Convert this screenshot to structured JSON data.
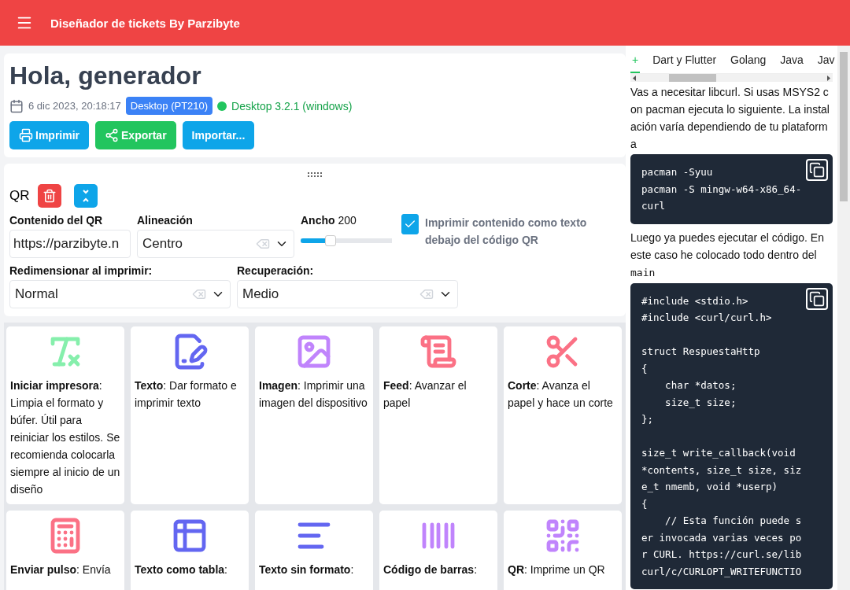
{
  "header": {
    "title": "Diseñador de tickets By Parzibyte"
  },
  "summary": {
    "heading": "Hola, generador",
    "date": "6 dic 2023, 20:18:17",
    "printer_badge": "Desktop (PT210)",
    "status": {
      "text": "Desktop 3.2.1 (windows)",
      "color": "#22c55e"
    },
    "buttons": [
      {
        "label": "Imprimir",
        "kind": "print"
      },
      {
        "label": "Exportar",
        "kind": "share"
      },
      {
        "label": "Importar...",
        "kind": "plain"
      }
    ]
  },
  "qr_block": {
    "title": "QR",
    "content": {
      "label": "Contenido del QR",
      "value": "https://parzibyte.n"
    },
    "alignment": {
      "label": "Alineación",
      "value": "Centro"
    },
    "width": {
      "label": "Ancho",
      "reading": "200",
      "level": 0.3
    },
    "print_text": {
      "label": "Imprimir contenido como texto debajo del código QR",
      "checked": true
    },
    "resize": {
      "label": "Redimensionar al imprimir:",
      "value": "Normal"
    },
    "recovery": {
      "label": "Recuperación:",
      "value": "Medio"
    }
  },
  "cards": [
    {
      "kind": "reset",
      "text": "**Iniciar impresora**: Limpia el formato y búfer. Útil para reiniciar los estilos. Se recomienda colocarla siempre al inicio de un diseño"
    },
    {
      "kind": "text",
      "text": "**Texto**: Dar formato e imprimir texto"
    },
    {
      "kind": "image",
      "text": "**Imagen**: Imprimir una imagen del dispositivo"
    },
    {
      "kind": "feed",
      "text": "**Feed**: Avanzar el papel"
    },
    {
      "kind": "cut",
      "text": "**Corte**: Avanza el papel y hace un corte"
    },
    {
      "kind": "pulse",
      "text": "**Enviar pulso**: Envía"
    },
    {
      "kind": "table",
      "text": "**Texto como tabla**:"
    },
    {
      "kind": "plain",
      "text": "**Texto sin formato**:"
    },
    {
      "kind": "barcode",
      "text": "**Código de barras**:"
    },
    {
      "kind": "qr",
      "text": "**QR**: Imprime un QR"
    }
  ],
  "docs": {
    "tabs": [
      {
        "label": "+",
        "selected": true
      },
      {
        "label": "Dart y Flutter",
        "selected": false
      },
      {
        "label": "Golang",
        "selected": false
      },
      {
        "label": "Java",
        "selected": false
      },
      {
        "label": "Jav",
        "selected": false
      }
    ],
    "blocks": [
      {
        "kind": "text",
        "text": "Vas a necesitar libcurl. Si usas MSYS2 con pacman ejecuta lo siguiente. La instalación varía dependiendo de tu plataforma"
      },
      {
        "kind": "code",
        "text": "pacman -Syuu\npacman -S mingw-w64-x86_64-\ncurl"
      },
      {
        "kind": "text",
        "text": "Luego ya puedes ejecutar el código. En este caso he colocado todo dentro del",
        "inline_code": "main"
      },
      {
        "kind": "code",
        "text": "#include <stdio.h>\n#include <curl/curl.h>\n\nstruct RespuestaHttp\n{\n    char *datos;\n    size_t size;\n};\n\nsize_t write_callback(void\n*contents, size_t size, siz\ne_t nmemb, void *userp)\n{\n    // Esta función puede s\ner invocada varias veces po\nr CURL. https://curl.se/lib\ncurl/c/CURLOPT_WRITEFUNCTIO"
      }
    ]
  }
}
